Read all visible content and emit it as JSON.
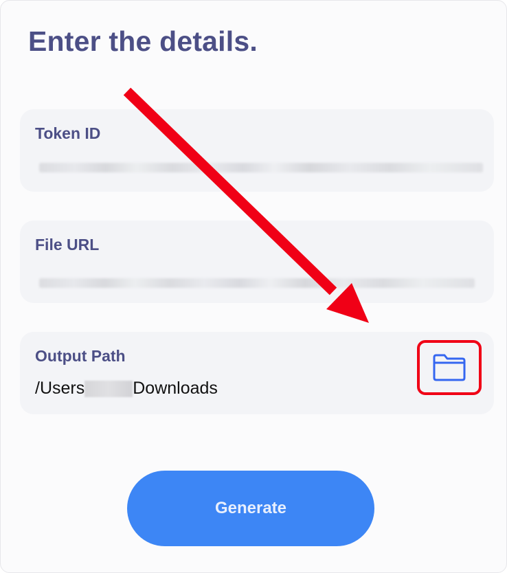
{
  "page": {
    "title": "Enter the details."
  },
  "fields": {
    "token_id": {
      "label": "Token ID"
    },
    "file_url": {
      "label": "File URL"
    },
    "output_path": {
      "label": "Output Path",
      "value_prefix": "/Users",
      "value_suffix": "Downloads",
      "browse_icon": "folder-icon"
    }
  },
  "actions": {
    "generate_label": "Generate"
  },
  "colors": {
    "title": "#4c4f86",
    "card_bg": "#f3f4f7",
    "accent_button": "#3d86f5",
    "folder_icon": "#3466f0",
    "annotation": "#f00016"
  }
}
